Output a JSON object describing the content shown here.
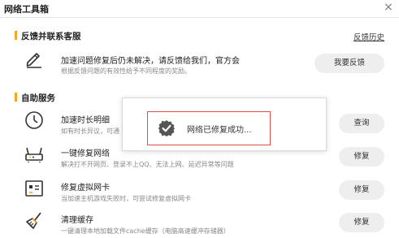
{
  "window": {
    "title": "网络工具箱",
    "close_glyph": "×"
  },
  "feedback_section": {
    "heading": "反馈并联系客服",
    "history_link": "反馈历史",
    "item": {
      "title": "加速问题修复后仍未解决，请反馈给我们，官方会",
      "desc": "根据反馈问题的有效性给予不同程度的奖励。",
      "button": "我要反馈",
      "icon": "pencil-icon"
    }
  },
  "self_service_section": {
    "heading": "自助服务",
    "items": [
      {
        "title": "加速时长明细",
        "desc": "如有时长异议，可通",
        "button": "查询",
        "icon": "clock-icon"
      },
      {
        "title": "一键修复网络",
        "desc": "解决打不开网页、登录不上QQ、无法上网、延迟异常等问题",
        "button": "修复",
        "icon": "router-icon"
      },
      {
        "title": "修复虚拟网卡",
        "desc": "当加速主机游戏失败时，可尝试修复虚拟网卡",
        "button": "修复",
        "icon": "network-card-icon"
      },
      {
        "title": "清理缓存",
        "desc": "一键清理本地加载文件cache缓存（电脑高速缓冲存储器）",
        "button": "修复",
        "icon": "broom-icon"
      }
    ]
  },
  "toast": {
    "message": "网络已修复成功...",
    "icon": "check-badge-icon",
    "border_color": "#e14b4b"
  },
  "colors": {
    "accent": "#f5a623",
    "button_bg": "#eeeeee"
  }
}
